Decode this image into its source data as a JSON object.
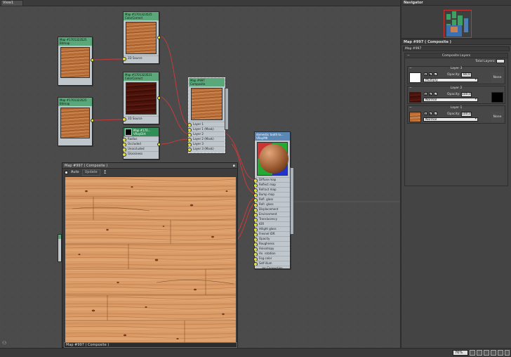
{
  "view": {
    "tab_label": "View1"
  },
  "nodes": {
    "bitmap1": {
      "title": "Map #1701323525",
      "subtitle": "Bitmap"
    },
    "bitmap2": {
      "title": "Map #1701323525",
      "subtitle": "Bitmap"
    },
    "cc1": {
      "title": "Map #1701323525",
      "subtitle": "ColorCorrect",
      "slot": "2D Source"
    },
    "cc2": {
      "title": "Map #1701323531",
      "subtitle": "ColorCorrect",
      "slot": "2D Source"
    },
    "vraydirt": {
      "title": "Map #170...",
      "subtitle": "VRayDirt",
      "slots": [
        "Radius",
        "Occluded",
        "Unoccluded",
        "Glossiness"
      ]
    },
    "composite": {
      "title": "Map #997",
      "subtitle": "Composite",
      "slots": [
        "Layer 1",
        "Layer 1 (Mask)",
        "Layer 2",
        "Layer 2 (Mask)",
        "Layer 3",
        "Layer 3 (Mask)"
      ]
    },
    "vraymtl": {
      "title": "domestic tooth lo...",
      "subtitle": "VRayMtl",
      "slots": [
        "Diffuse map",
        "Reflect map",
        "Refract map",
        "Bump map",
        "Refl. gloss",
        "Refr. gloss",
        "Displacement",
        "Environment",
        "Translucency",
        "IOR",
        "Hilight gloss",
        "Fresnel IOR",
        "Opacity",
        "Roughness",
        "Anisotropy",
        "An. rotation",
        "Fog color",
        "Self-illum"
      ],
      "footer": "mr Connection"
    }
  },
  "preview": {
    "title": "Map #997  ( Composite )",
    "auto_label": "Auto",
    "update_label": "Update",
    "bottom_label": "Map #997  ( Composite )"
  },
  "navigator": {
    "title": "Navigator"
  },
  "params": {
    "title": "Map #997  ( Composite )",
    "subtitle": "Map #997",
    "section_title": "Composite Layers",
    "total_layers_label": "Total Layers:",
    "total_layers_value": "",
    "layers": [
      {
        "name": "Layer 3",
        "opacity_label": "Opacity:",
        "opacity": "80,0",
        "blend": "Multiply",
        "mask": "None"
      },
      {
        "name": "Layer 2",
        "opacity_label": "Opacity:",
        "opacity": "100,0",
        "blend": "Normal",
        "mask": ""
      },
      {
        "name": "Layer 1",
        "opacity_label": "Opacity:",
        "opacity": "100,0",
        "blend": "Normal",
        "mask": "None"
      }
    ]
  },
  "status": {
    "zoom": "76%"
  }
}
